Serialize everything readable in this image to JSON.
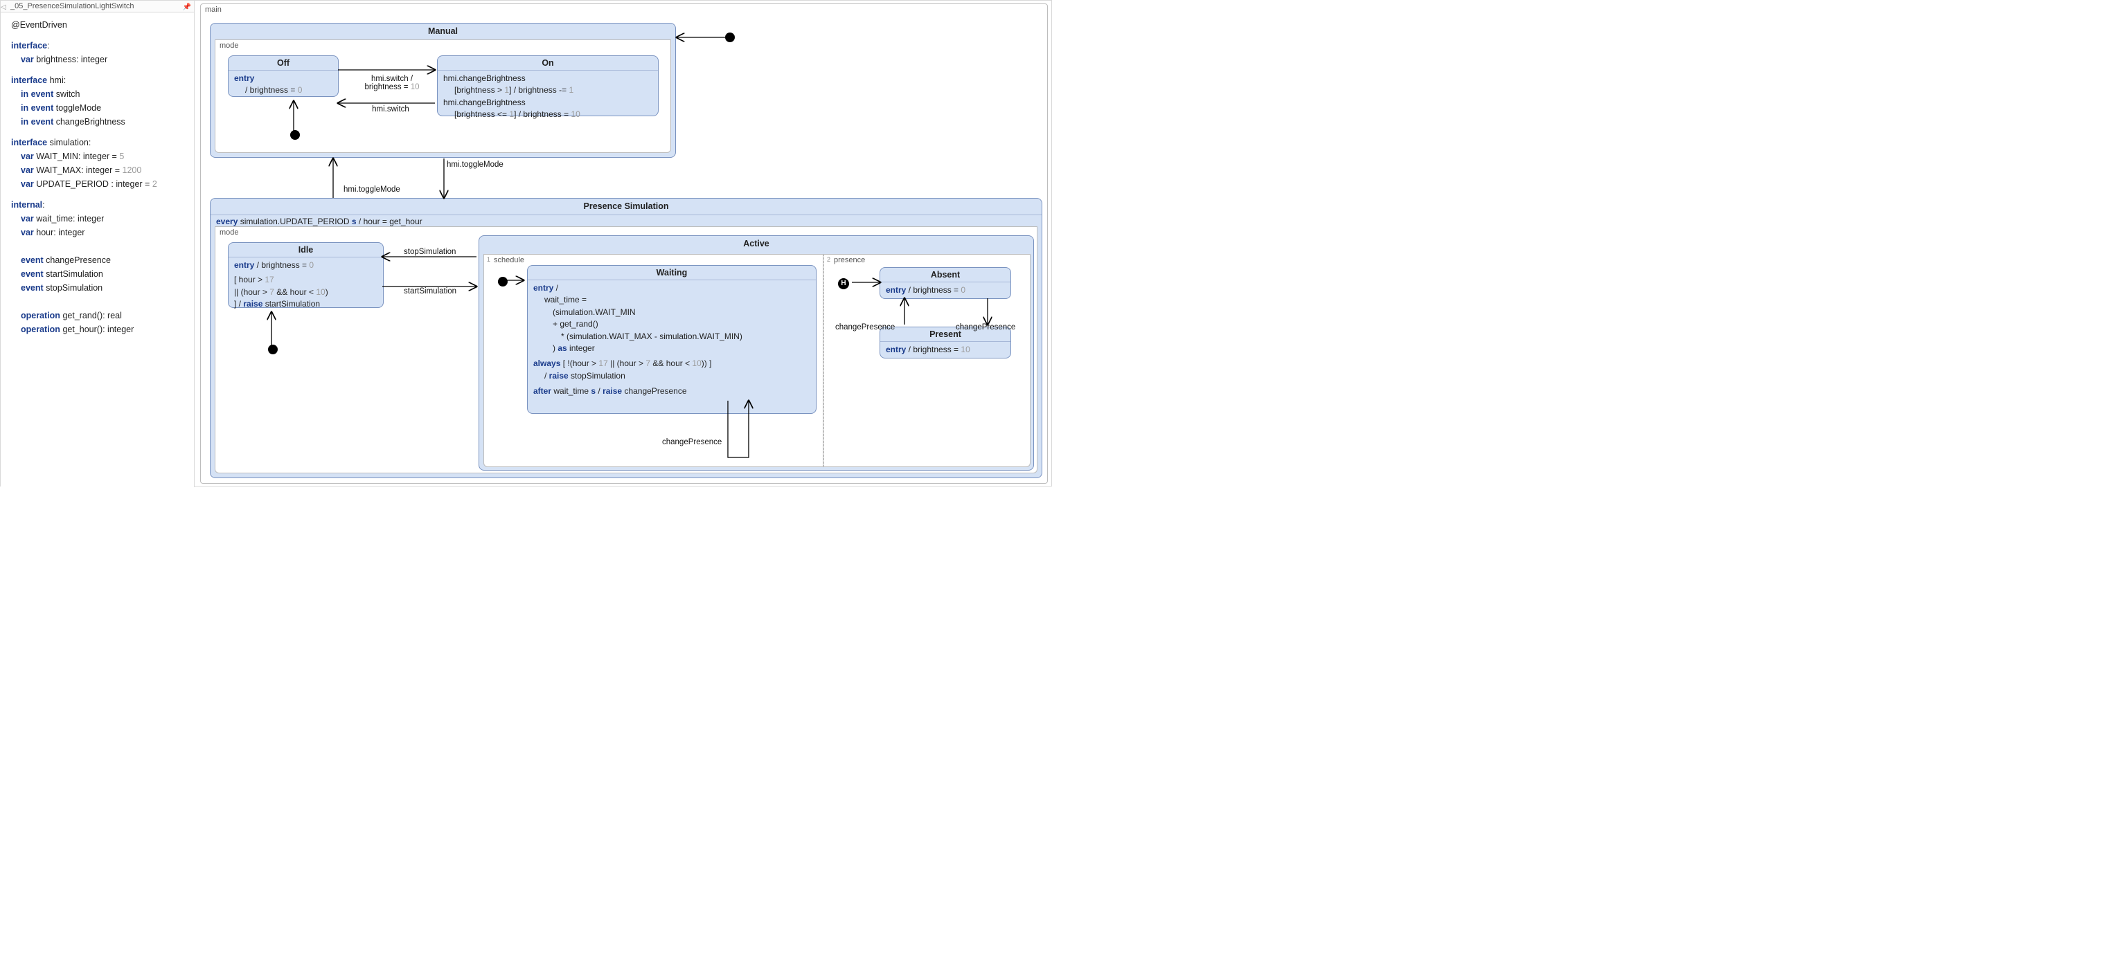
{
  "sidebar": {
    "file_name": "_05_PresenceSimulationLightSwitch",
    "annotation": "@EventDriven",
    "iface_default": {
      "heading": "interface",
      "var_brightness": "var",
      "brightness": "brightness: integer"
    },
    "iface_hmi": {
      "heading": "interface",
      "name": "hmi:",
      "in_event": "in event",
      "switch": "switch",
      "toggleMode": "toggleMode",
      "changeBrightness": "changeBrightness"
    },
    "iface_sim": {
      "heading": "interface",
      "name": "simulation:",
      "var": "var",
      "wait_min": "WAIT_MIN: integer = ",
      "wait_min_v": "5",
      "wait_max": "WAIT_MAX: integer = ",
      "wait_max_v": "1200",
      "upd": "UPDATE_PERIOD : integer = ",
      "upd_v": "2"
    },
    "internal": {
      "heading": "internal",
      "var": "var",
      "wait_time": "wait_time: integer",
      "hour": "hour: integer",
      "event": "event",
      "changePresence": "changePresence",
      "startSimulation": "startSimulation",
      "stopSimulation": "stopSimulation",
      "operation": "operation",
      "get_rand": "get_rand(): real",
      "get_hour": "get_hour(): integer"
    }
  },
  "canvas": {
    "main_region": "main",
    "manual": {
      "title": "Manual",
      "region": "mode",
      "off": {
        "title": "Off",
        "entry_kw": "entry",
        "entry_action": "/ brightness = ",
        "entry_value": "0"
      },
      "on": {
        "title": "On",
        "l1": "hmi.changeBrightness",
        "l2a": "[brightness > ",
        "l2n": "1",
        "l2b": "] / brightness -= ",
        "l2v": "1",
        "l3": "hmi.changeBrightness",
        "l4a": "[brightness <= ",
        "l4n": "1",
        "l4b": "] / brightness = ",
        "l4v": "10"
      },
      "t_off_on_1": "hmi.switch /",
      "t_off_on_2": "brightness = ",
      "t_off_on_v": "10",
      "t_on_off": "hmi.switch"
    },
    "between": {
      "to_presence": "hmi.toggleMode",
      "to_manual": "hmi.toggleMode"
    },
    "presence": {
      "title": "Presence Simulation",
      "spec_kw": "every",
      "spec_mid": "simulation.UPDATE_PERIOD ",
      "spec_unit": "s",
      "spec_rest": " /  hour = get_hour",
      "region": "mode",
      "idle": {
        "title": "Idle",
        "entry_kw": "entry",
        "entry_action": " / brightness = ",
        "entry_value": "0",
        "g1a": "[ hour > ",
        "g1n": "17",
        "g2a": "|| (hour > ",
        "g2n1": "7",
        "g2b": " && hour < ",
        "g2n2": "10",
        "g2c": ")",
        "g3a": "] / ",
        "g3kw": "raise",
        "g3b": " startSimulation"
      },
      "t_stop": "stopSimulation",
      "t_start": "startSimulation",
      "active": {
        "title": "Active",
        "schedule": {
          "name": "schedule",
          "index": "1",
          "waiting": {
            "title": "Waiting",
            "entry_kw": "entry",
            "entry_slash": " /",
            "l1": "wait_time =",
            "l2": "(simulation.WAIT_MIN",
            "l3": "+ get_rand()",
            "l4": "* (simulation.WAIT_MAX - simulation.WAIT_MIN)",
            "l5a": ") ",
            "l5kw": "as",
            "l5b": " integer",
            "always_kw": "always",
            "always_a": " [ !(hour > ",
            "always_n1": "17",
            "always_b": " || (hour > ",
            "always_n2": "7",
            "always_c": " && hour < ",
            "always_n3": "10",
            "always_d": ")) ]",
            "always2a": "/ ",
            "always2kw": "raise",
            "always2b": " stopSimulation",
            "after_kw": "after",
            "after_a": " wait_time ",
            "after_unit": "s",
            "after_b": " / ",
            "after_kw2": "raise",
            "after_c": " changePresence"
          },
          "t_self": "changePresence"
        },
        "presence_r": {
          "name": "presence",
          "index": "2",
          "absent": {
            "title": "Absent",
            "entry_kw": "entry",
            "entry_action": " / brightness = ",
            "entry_value": "0"
          },
          "present": {
            "title": "Present",
            "entry_kw": "entry",
            "entry_action": " / brightness = ",
            "entry_value": "10"
          },
          "t_down": "changePresence",
          "t_up": "changePresence"
        }
      }
    }
  }
}
